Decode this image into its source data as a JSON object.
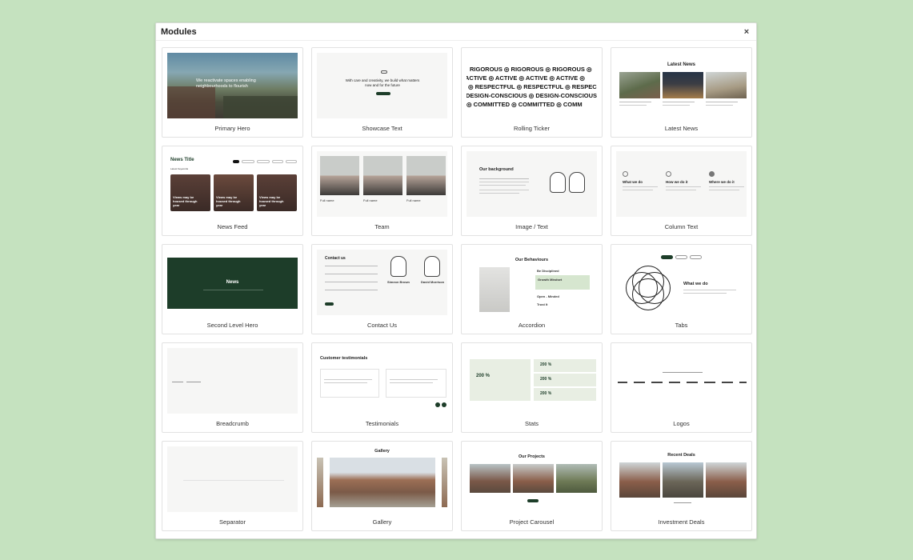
{
  "dialog": {
    "title": "Modules",
    "close_label": "×"
  },
  "modules": [
    {
      "label": "Primary Hero",
      "text": "We reactivate spaces enabling neighbourhoods to flourish"
    },
    {
      "label": "Showcase Text",
      "text": "With care and creativity, we build what matters now and for the future"
    },
    {
      "label": "Rolling Ticker",
      "rows": [
        "RIGOROUS ◎ RIGOROUS ◎ RIGOROUS ◎",
        "ACTIVE ◎ ACTIVE ◎ ACTIVE ◎ ACTIVE ◎",
        "◎ RESPECTFUL ◎ RESPECTFUL ◎ RESPEC",
        "DESIGN-CONSCIOUS ◎ DESIGN-CONSCIOUS ◎",
        "◎ COMMITTED ◎ COMMITTED ◎ COMM"
      ]
    },
    {
      "label": "Latest News",
      "heading": "Latest News"
    },
    {
      "label": "News Feed",
      "heading": "News Title",
      "subheading": "Latest Keywords",
      "item_title": "Views may be housed through year"
    },
    {
      "label": "Team",
      "member_name": "Full name"
    },
    {
      "label": "Image / Text",
      "heading": "Our background"
    },
    {
      "label": "Column Text",
      "columns": [
        "What we do",
        "How we do it",
        "Where we do it"
      ]
    },
    {
      "label": "Second Level Hero",
      "heading": "News"
    },
    {
      "label": "Contact Us",
      "heading": "Contact us",
      "people": [
        "Simeon Brown",
        "David Morrison"
      ]
    },
    {
      "label": "Accordion",
      "heading": "Our Behaviours",
      "items": [
        "Be Disciplined",
        "Growth Mindset",
        "Open - Minded",
        "Trust It"
      ]
    },
    {
      "label": "Tabs",
      "heading": "What we do"
    },
    {
      "label": "Breadcrumb"
    },
    {
      "label": "Testimonials",
      "heading": "Customer testimonials"
    },
    {
      "label": "Stats",
      "value": "200 %"
    },
    {
      "label": "Logos"
    },
    {
      "label": "Separator"
    },
    {
      "label": "Gallery",
      "heading": "Gallery"
    },
    {
      "label": "Project Carousel",
      "heading": "Our Projects"
    },
    {
      "label": "Investment Deals",
      "heading": "Recent Deals"
    }
  ],
  "colors": {
    "background": "#c5e2bf",
    "brand_green": "#1d3d29",
    "highlight": "#d6e6cf"
  }
}
